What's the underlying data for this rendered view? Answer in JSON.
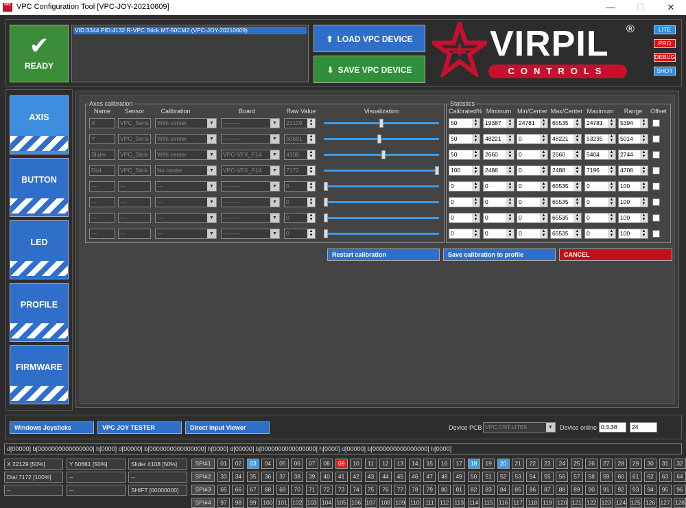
{
  "window": {
    "title": "VPC Configuration Tool [VPC-JOY-20210609]",
    "icon_text": "VPC",
    "controls": [
      "—",
      "☐",
      "✕"
    ]
  },
  "ready": {
    "label": "READY"
  },
  "device_list": {
    "selected": "VID:3344 PID:4132 R-VPC Stick MT-50CM2 (VPC-JOY-20210609)"
  },
  "buttons": {
    "load": "LOAD VPC DEVICE",
    "save": "SAVE VPC DEVICE"
  },
  "logo": {
    "word": "VIRPIL",
    "sub": "CONTROLS",
    "reg": "®"
  },
  "editions": [
    {
      "label": "LITE",
      "color": "#2f8ee0"
    },
    {
      "label": "PRO",
      "color": "#e01010"
    },
    {
      "label": "DEBUG",
      "color": "#e01010"
    },
    {
      "label": "SHOT",
      "color": "#2f8ee0"
    }
  ],
  "nav": [
    "AXIS",
    "BUTTON",
    "LED",
    "PROFILE",
    "FIRMWARE"
  ],
  "axes": {
    "legend": "Axes calibration",
    "headers": {
      "name": "Name",
      "sensor": "Sensor",
      "calibration": "Calibration",
      "board": "Board",
      "raw": "Raw Value",
      "vis": "Visualization"
    },
    "rows": [
      {
        "name": "X",
        "sensor": "VPC_Sens",
        "calibration": "With center",
        "board": "---------",
        "raw": "22129",
        "pos": 0.5
      },
      {
        "name": "Y",
        "sensor": "VPC_Sens",
        "calibration": "With center",
        "board": "---------",
        "raw": "50681",
        "pos": 0.48
      },
      {
        "name": "Slider",
        "sensor": "VPC_Stick",
        "calibration": "With center",
        "board": "VPC-VFX_F14",
        "raw": "4108",
        "pos": 0.52
      },
      {
        "name": "Dial",
        "sensor": "VPC_Stick",
        "calibration": "No center",
        "board": "VPC-VFX_F14",
        "raw": "7172",
        "pos": 1.0
      },
      {
        "name": "---",
        "sensor": "---",
        "calibration": "---",
        "board": "---------",
        "raw": "0",
        "pos": 0
      },
      {
        "name": "---",
        "sensor": "---",
        "calibration": "---",
        "board": "---------",
        "raw": "0",
        "pos": 0
      },
      {
        "name": "---",
        "sensor": "---",
        "calibration": "---",
        "board": "---------",
        "raw": "0",
        "pos": 0
      },
      {
        "name": "---",
        "sensor": "---",
        "calibration": "---",
        "board": "---------",
        "raw": "0",
        "pos": 0
      }
    ]
  },
  "stats": {
    "legend": "Statistics",
    "headers": [
      "Calibrated%",
      "Minimum",
      "Min/Center",
      "Max/Center",
      "Maximum",
      "Range",
      "Offset"
    ],
    "rows": [
      [
        "50",
        "19387",
        "24781",
        "65535",
        "24781",
        "5394"
      ],
      [
        "50",
        "48221",
        "0",
        "48221",
        "53235",
        "5014"
      ],
      [
        "50",
        "2660",
        "0",
        "2660",
        "5404",
        "2744"
      ],
      [
        "100",
        "2488",
        "0",
        "2488",
        "7196",
        "4708"
      ],
      [
        "0",
        "0",
        "0",
        "65535",
        "0",
        "100"
      ],
      [
        "0",
        "0",
        "0",
        "65535",
        "0",
        "100"
      ],
      [
        "0",
        "0",
        "0",
        "65535",
        "0",
        "100"
      ],
      [
        "0",
        "0",
        "0",
        "65535",
        "0",
        "100"
      ]
    ]
  },
  "actions": {
    "restart": "Restart calibration",
    "save_profile": "Save calibration  to profile",
    "cancel": "CANCEL"
  },
  "bottom": {
    "win_joy": "Windows Joysticks",
    "joy_tester": "VPC JOY TESTER",
    "di_viewer": "Direct Input Viewer",
    "device_pcb_label": "Device PCB",
    "device_pcb": "VPC.CNT.LITE5",
    "online_label": "Device online",
    "online_time": "0:3:38",
    "online_count": "24"
  },
  "status_line": "d[00000] b[0000000000000000] h[0000]    d[00000] b[0000000000000000] h[0000]    d[00000] b[0000000000000000] h[0000]    d[00000] b[0000000000000000] h[0000]",
  "axis_status": [
    [
      "X 22129 [50%]",
      "Y 50681 [50%]",
      "Slider 4108 [50%]"
    ],
    [
      "Dial 7172 [100%]",
      "--",
      "--"
    ],
    [
      "--",
      "--",
      "SHIFT [00000000]"
    ]
  ],
  "spi": [
    "SPI#1",
    "SPI#2",
    "SPI#3",
    "SPI#4"
  ],
  "button_grid": {
    "active_blue": [
      3,
      18,
      20
    ],
    "active_red": [
      9
    ]
  }
}
